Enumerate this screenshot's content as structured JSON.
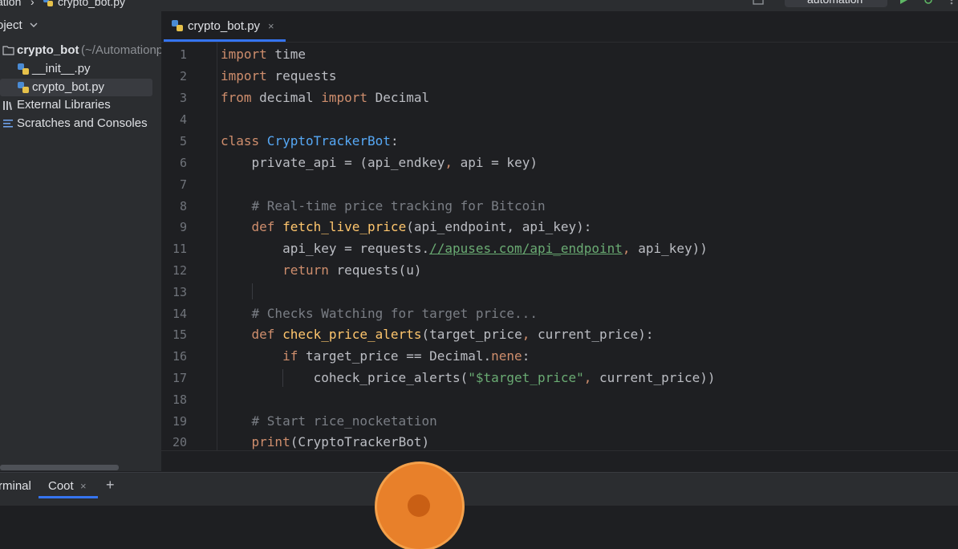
{
  "header": {
    "project_breadcrumb": "ation",
    "breadcrumb_sep": "›",
    "file_breadcrumb": "crypto_bot.py",
    "run_config": "automation"
  },
  "project_panel": {
    "title": "oject",
    "root_name": "crypto_bot",
    "root_path": "(~/Automationp",
    "items": [
      {
        "label": "__init__.py"
      },
      {
        "label": "crypto_bot.py"
      },
      {
        "label": "External Libraries"
      },
      {
        "label": "Scratches and Consoles"
      }
    ]
  },
  "editor": {
    "tab_label": "crypto_bot.py",
    "tab_close": "×",
    "line_numbers": [
      "1",
      "2",
      "3",
      "4",
      "5",
      "6",
      "7",
      "8",
      "9",
      "11",
      "12",
      "13",
      "14",
      "15",
      "16",
      "17",
      "18",
      "19",
      "20"
    ],
    "code": {
      "l1_kw": "import",
      "l1_rest": " time",
      "l2_kw": "import",
      "l2_rest": " requests",
      "l3_kw1": "from",
      "l3_mid": " decimal ",
      "l3_kw2": "import",
      "l3_rest": " Decimal",
      "l5_kw": "class",
      "l5_cls": " CryptoTrackerBot",
      "l5_rest": ":",
      "l6_a": "    private_api = (api_endkey",
      "l6_comma": ",",
      "l6_b": " api = key)",
      "l8": "    # Real-time price tracking for Bitcoin",
      "l9_kw": "    def",
      "l9_fn": " fetch_live_price",
      "l9_rest": "(api_endpoint, api_key):",
      "l11_a": "        api_key = requests.",
      "l11_link": "//apuses.com/api_endpoint",
      "l11_comma": ",",
      "l11_b": " api_key))",
      "l12_kw": "        return",
      "l12_rest": " requests(u)",
      "l14": "    # Checks Watching for target price...",
      "l15_kw": "    def",
      "l15_fn": " check_price_alerts",
      "l15_a": "(target_price",
      "l15_comma": ",",
      "l15_b": " current_price):",
      "l16_kw": "        if",
      "l16_a": " target_price == Decimal.",
      "l16_kw2": "nene",
      "l16_b": ":",
      "l17_a": "            coheck_price_alerts(",
      "l17_str": "\"$target_price\"",
      "l17_comma": ",",
      "l17_b": " current_price))",
      "l19": "    # Start rice_nocketation",
      "l20_kw": "    print",
      "l20_rest": "(CryptoTrackerBot)"
    }
  },
  "bottom_panel": {
    "tabs": [
      {
        "label": "rminal"
      },
      {
        "label": "Coot"
      }
    ],
    "close": "×",
    "add": "+"
  },
  "colors": {
    "keyword": "#cf8e6d",
    "class_name": "#56a8f5",
    "function_name": "#ffc66d",
    "comment": "#7a7e85",
    "string": "#6aab73",
    "accent": "#3574f0",
    "record_button": "#e8802a"
  },
  "icons": {
    "file": "python-file-icon",
    "folder": "folder-icon",
    "libraries": "library-icon",
    "scratches": "scratches-icon",
    "run": "run-icon",
    "debug": "debug-icon",
    "record": "record-button-icon"
  }
}
